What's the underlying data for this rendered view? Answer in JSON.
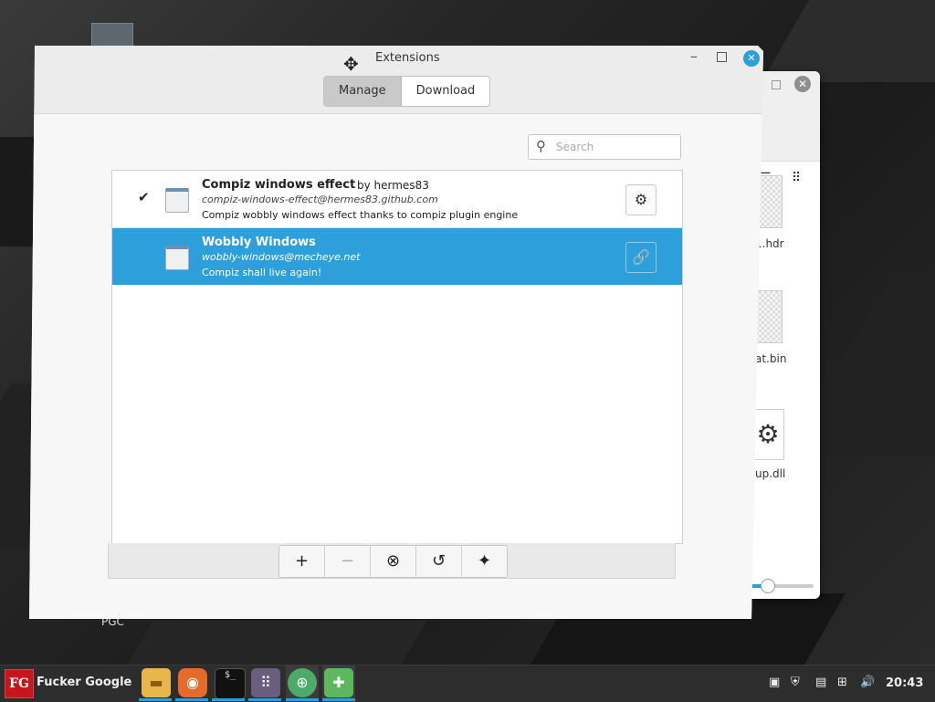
{
  "desktop": {
    "icon_label": "PGC"
  },
  "background_window": {
    "close_glyph": "✕",
    "list_view_glyph": "☰",
    "grid_view_glyph": "⠿",
    "files": [
      {
        "label": "1.hdr"
      },
      {
        "label": "at.bin"
      },
      {
        "label": "up.dll"
      }
    ],
    "zoom_fraction": 0.25
  },
  "dialog": {
    "title": "Extensions",
    "move_glyph": "✥",
    "minimize_glyph": "–",
    "close_glyph": "✕",
    "tabs": [
      {
        "label": "Manage",
        "active": true
      },
      {
        "label": "Download",
        "active": false
      }
    ],
    "search": {
      "glyph": "⚲",
      "placeholder": "Search",
      "value": ""
    },
    "extensions": [
      {
        "enabled": true,
        "check_glyph": "✔",
        "name": "Compiz windows effect",
        "by": "by hermes83",
        "uuid": "compiz-windows-effect@hermes83.github.com",
        "description": "Compiz wobbly windows effect thanks to compiz plugin engine",
        "config_glyph": "⚙",
        "selected": false
      },
      {
        "enabled": false,
        "check_glyph": "",
        "name": "Wobbly Windows",
        "by": "",
        "uuid": "wobbly-windows@mecheye.net",
        "description": "Compiz shall live again!",
        "config_glyph": "🔗",
        "selected": true
      }
    ],
    "toolbar": [
      {
        "name": "add-button",
        "glyph": "+",
        "enabled": true
      },
      {
        "name": "remove-button",
        "glyph": "−",
        "enabled": false
      },
      {
        "name": "uninstall-button",
        "glyph": "⊗",
        "enabled": true
      },
      {
        "name": "restore-button",
        "glyph": "↺",
        "enabled": true
      },
      {
        "name": "more-button",
        "glyph": "✦",
        "enabled": true
      }
    ]
  },
  "taskbar": {
    "menu_logo": "FG",
    "menu_label": "Fucker Google",
    "launchers": [
      {
        "name": "files-launcher",
        "glyph": "▬"
      },
      {
        "name": "firefox-launcher",
        "glyph": "◉"
      },
      {
        "name": "terminal-launcher",
        "glyph": "$_"
      },
      {
        "name": "app-grid-launcher",
        "glyph": "⠿"
      },
      {
        "name": "web-launcher",
        "glyph": "⊕"
      },
      {
        "name": "extensions-launcher",
        "glyph": "✚"
      }
    ],
    "tray": {
      "notes_glyph": "▣",
      "shield_glyph": "⛨",
      "clipboard_glyph": "▤",
      "network_glyph": "⊞",
      "volume_glyph": "🔊"
    },
    "clock": "20:43",
    "accent": "#2b9fd8"
  }
}
